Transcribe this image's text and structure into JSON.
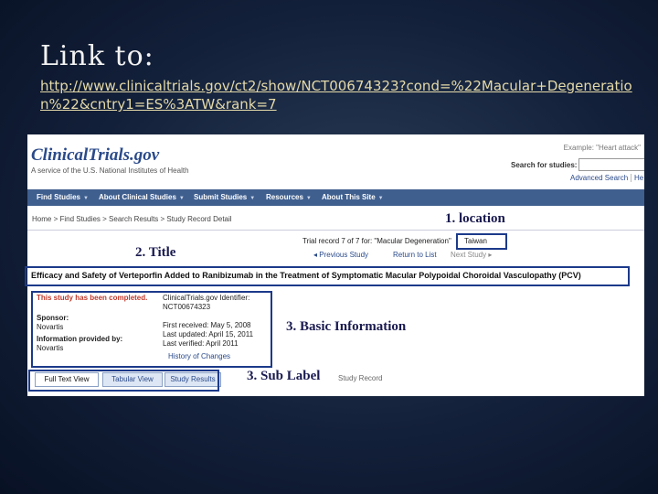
{
  "slide": {
    "heading": "Link to:",
    "link_url": "http://www.clinicaltrials.gov/ct2/show/NCT00674323?cond=%22Macular+Degeneration%22&cntry1=ES%3ATW&rank=7"
  },
  "site": {
    "logo": "ClinicalTrials.gov",
    "tagline": "A service of the U.S. National Institutes of Health",
    "example": "Example: \"Heart attack\"",
    "search_label": "Search for studies:",
    "search_value": "",
    "advanced_search": "Advanced Search",
    "help": "He"
  },
  "nav": {
    "items": [
      "Find Studies",
      "About Clinical Studies",
      "Submit Studies",
      "Resources",
      "About This Site"
    ]
  },
  "breadcrumb": "Home > Find Studies > Search Results > Study Record Detail",
  "record_nav": {
    "trial_record": "Trial record 7 of 7 for:  \"Macular Degeneration\"",
    "location": "Taiwan",
    "prev": "◂ Previous Study",
    "return": "Return to List",
    "next": "Next Study ▸"
  },
  "study": {
    "title": "Efficacy and Safety of Verteporfin Added to Ranibizumab in the Treatment of Symptomatic Macular Polypoidal Choroidal Vasculopathy (PCV)",
    "status": "This study has been completed.",
    "sponsor_label": "Sponsor:",
    "sponsor": "Novartis",
    "info_label": "Information provided by:",
    "info_by": "Novartis",
    "identifier_label": "ClinicalTrials.gov Identifier:",
    "identifier": "NCT00674323",
    "first_received": "First received: May 5, 2008",
    "last_updated": "Last updated: April 15, 2011",
    "last_verified": "Last verified: April 2011",
    "history": "History of Changes"
  },
  "tabs": {
    "full_text": "Full Text View",
    "tabular": "Tabular View",
    "results": "Study Results",
    "record": "Study Record"
  },
  "callouts": {
    "location": "1. location",
    "title": "2. Title",
    "basic_info": "3. Basic Information",
    "sub_label": "3. Sub Label"
  },
  "colors": {
    "annotation_box": "#1c3a8a",
    "nav_bar": "#3f5f8f",
    "link_text": "#e4d9a8"
  }
}
